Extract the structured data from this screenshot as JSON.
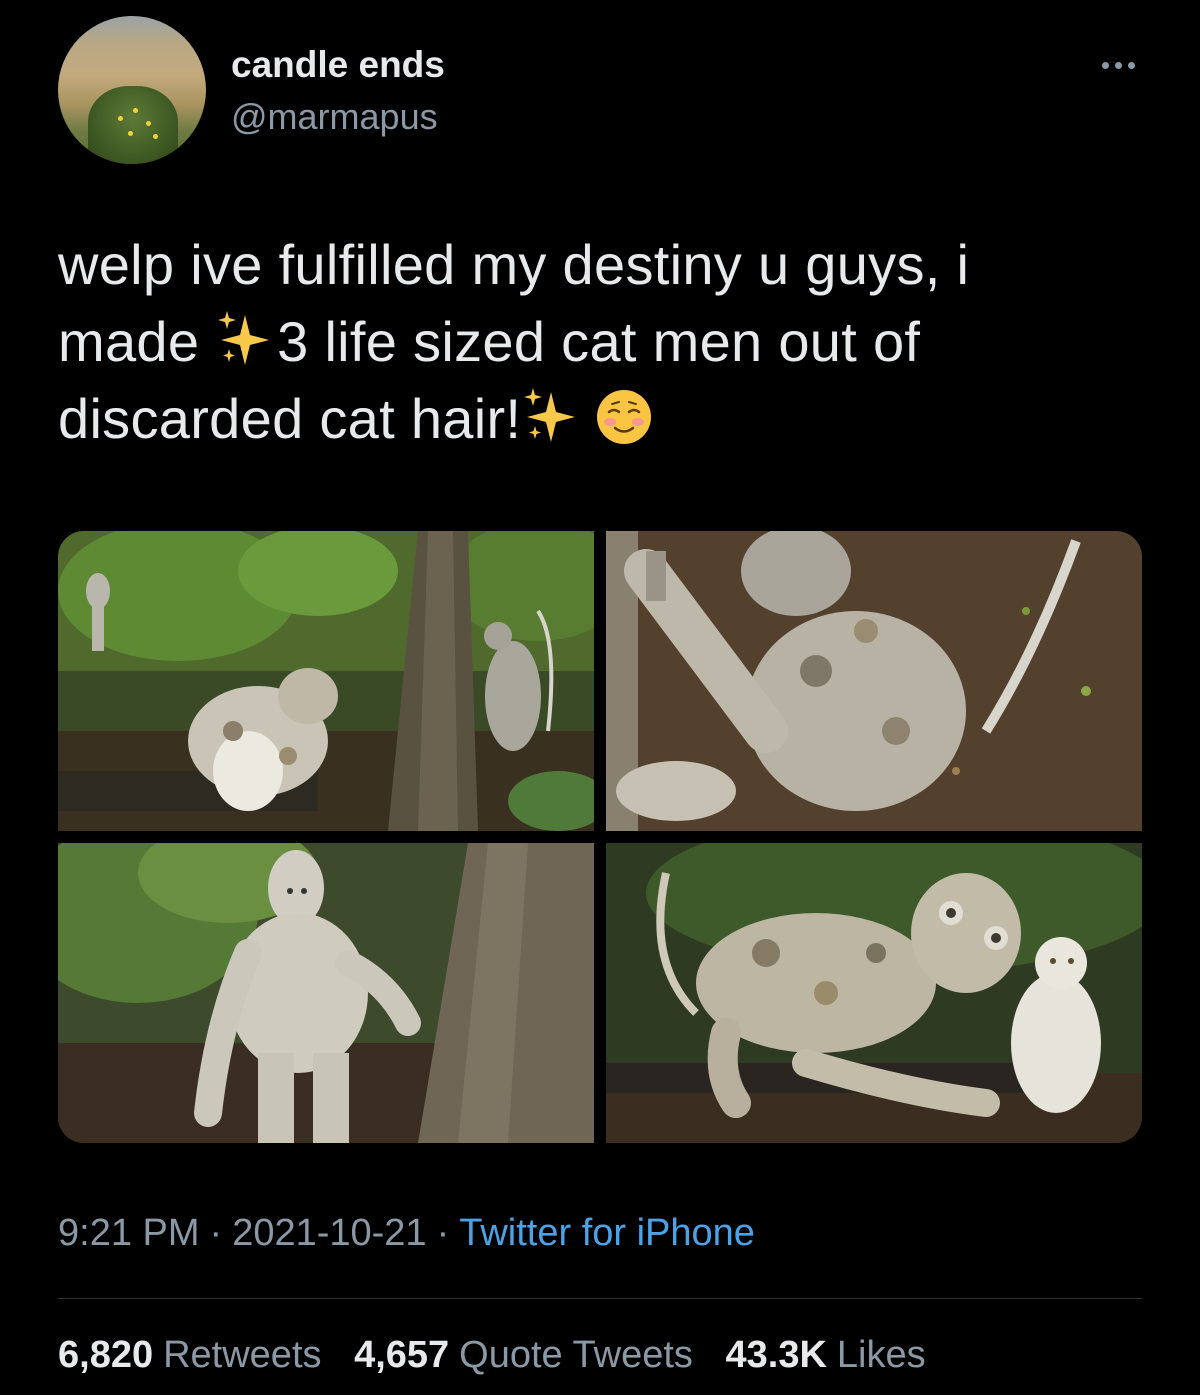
{
  "tweet": {
    "author": {
      "display_name": "candle ends",
      "handle": "@marmapus"
    },
    "text": {
      "line1": "welp ive fulfilled my destiny u guys, i",
      "line2_before": "made ",
      "line2_after": "3 life sized cat men out of",
      "line3_before": "discarded cat hair!"
    },
    "emojis": [
      "sparkles-icon",
      "sparkles-icon",
      "smiling-face-icon"
    ],
    "media_count": 4,
    "meta": {
      "time": "9:21 PM",
      "separator": "·",
      "date": "2021-10-21",
      "source": "Twitter for iPhone"
    },
    "stats": {
      "retweets_count": "6,820",
      "retweets_label": "Retweets",
      "quotes_count": "4,657",
      "quotes_label": "Quote Tweets",
      "likes_count": "43.3K",
      "likes_label": "Likes"
    }
  },
  "colors": {
    "background": "#000000",
    "primary_text": "#e7e9ea",
    "secondary_text": "#8b98a5",
    "link": "#4ba2e6",
    "divider": "#2f3336"
  }
}
